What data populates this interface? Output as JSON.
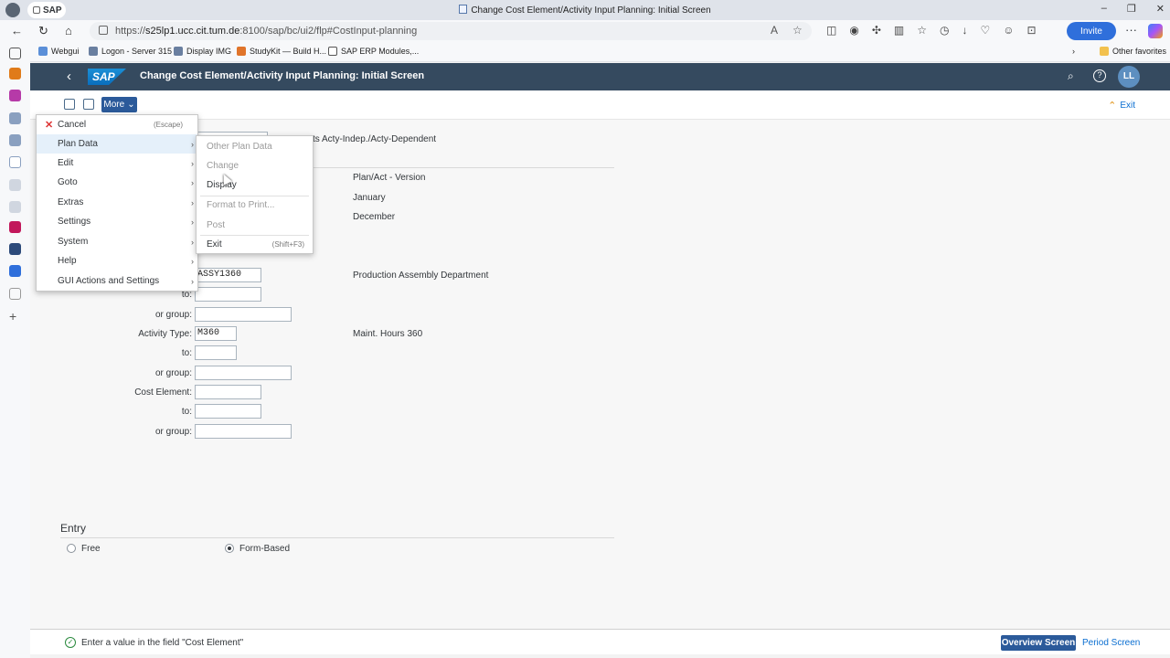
{
  "browser": {
    "tab_label": "SAP",
    "window_title": "Change Cost Element/Activity Input Planning: Initial Screen",
    "url_prefix": "https://",
    "url_host": "s25lp1.ucc.cit.tum.de",
    "url_rest": ":8100/sap/bc/ui2/flp#CostInput-planning",
    "invite_label": "Invite",
    "favorites": [
      "Webgui",
      "Logon - Server 315",
      "Display IMG",
      "StudyKit — Build H...",
      "SAP ERP Modules,..."
    ],
    "other_favorites": "Other favorites"
  },
  "shell": {
    "logo": "SAP",
    "title": "Change Cost Element/Activity Input Planning: Initial Screen",
    "avatar": "LL"
  },
  "toolbar": {
    "more_label": "More",
    "exit_label": "Exit"
  },
  "form": {
    "header_text": "ts Acty-Indep./Acty-Dependent",
    "version_desc": "Plan/Act - Version",
    "from_period_desc": "January",
    "to_period_desc": "December",
    "cost_center_value": "ASSY1360",
    "cost_center_desc": "Production  Assembly Department",
    "to_label": "to:",
    "group_label": "or group:",
    "activity_type_label": "Activity Type:",
    "activity_type_value": "M360",
    "activity_type_desc": "Maint. Hours 360",
    "cost_element_label": "Cost Element:"
  },
  "entry": {
    "title": "Entry",
    "free_label": "Free",
    "form_based_label": "Form-Based",
    "selected": "form-based"
  },
  "status": {
    "message": "Enter a value in the field \"Cost Element\"",
    "overview_label": "Overview Screen",
    "period_label": "Period Screen"
  },
  "menu": {
    "items": [
      {
        "label": "Cancel",
        "shortcut": "(Escape)"
      },
      {
        "label": "Plan Data"
      },
      {
        "label": "Edit"
      },
      {
        "label": "Goto"
      },
      {
        "label": "Extras"
      },
      {
        "label": "Settings"
      },
      {
        "label": "System"
      },
      {
        "label": "Help"
      },
      {
        "label": "GUI Actions and Settings"
      }
    ],
    "submenu": [
      {
        "label": "Other Plan Data"
      },
      {
        "label": "Change"
      },
      {
        "label": "Display"
      },
      {
        "label": "Format to Print..."
      },
      {
        "label": "Post"
      },
      {
        "label": "Exit",
        "shortcut": "(Shift+F3)"
      }
    ]
  }
}
